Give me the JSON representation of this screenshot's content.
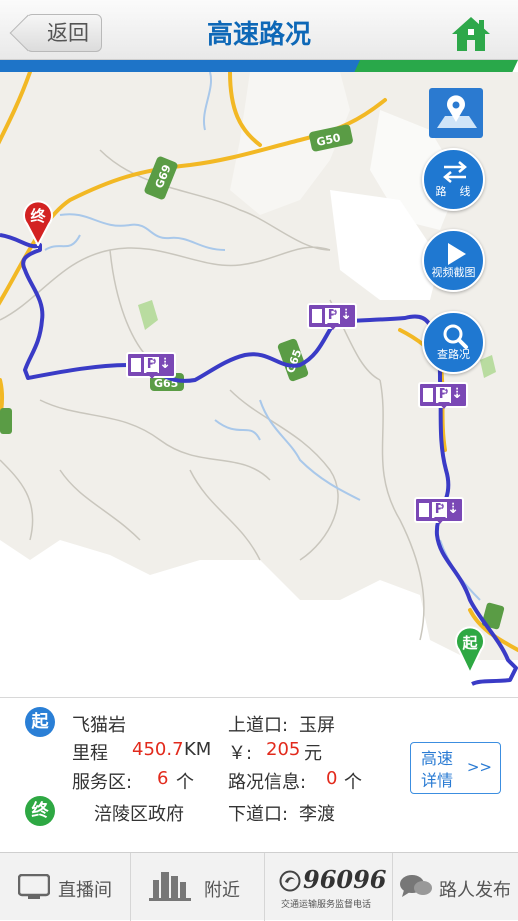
{
  "header": {
    "back_label": "返回",
    "title": "高速路况"
  },
  "map": {
    "road_labels": [
      "G50",
      "G69",
      "G65",
      "G65"
    ],
    "buttons": [
      {
        "label": "路　线",
        "icon": "swap-arrows-icon"
      },
      {
        "label": "视频截图",
        "icon": "play-icon"
      },
      {
        "label": "查路况",
        "icon": "search-icon"
      }
    ],
    "markers": {
      "start": "起",
      "end": "终"
    },
    "service_icon_text": "P"
  },
  "route": {
    "start_badge": "起",
    "start_name": "飞猫岩",
    "entry_label": "上道口:",
    "entry_value": "玉屏",
    "distance_label": "里程",
    "distance_value": "450.7",
    "distance_unit": "KM",
    "fee_label": "￥:",
    "fee_value": "205",
    "fee_unit": "元",
    "service_label": "服务区:",
    "service_value": "6",
    "service_unit": "个",
    "traffic_label": "路况信息:",
    "traffic_value": "0",
    "traffic_unit": "个",
    "end_badge": "终",
    "end_name": "涪陵区政府",
    "exit_label": "下道口:",
    "exit_value": "李渡",
    "detail_button_line1": "高速",
    "detail_button_line2": "详情",
    "detail_button_arrow": ">>"
  },
  "footer": {
    "tabs": [
      {
        "label": "直播间",
        "icon": "tv-icon"
      },
      {
        "label": "附近",
        "icon": "buildings-icon"
      },
      {
        "label": "96096",
        "sub": "交通运输服务监督电话",
        "icon": "phone-logo-icon"
      },
      {
        "label": "路人发布",
        "icon": "chat-bubbles-icon"
      }
    ]
  },
  "colors": {
    "brand_blue": "#0e68b7",
    "accent_green": "#29a84a",
    "route": "#3a3bc6",
    "value_red": "#e22a1c"
  }
}
